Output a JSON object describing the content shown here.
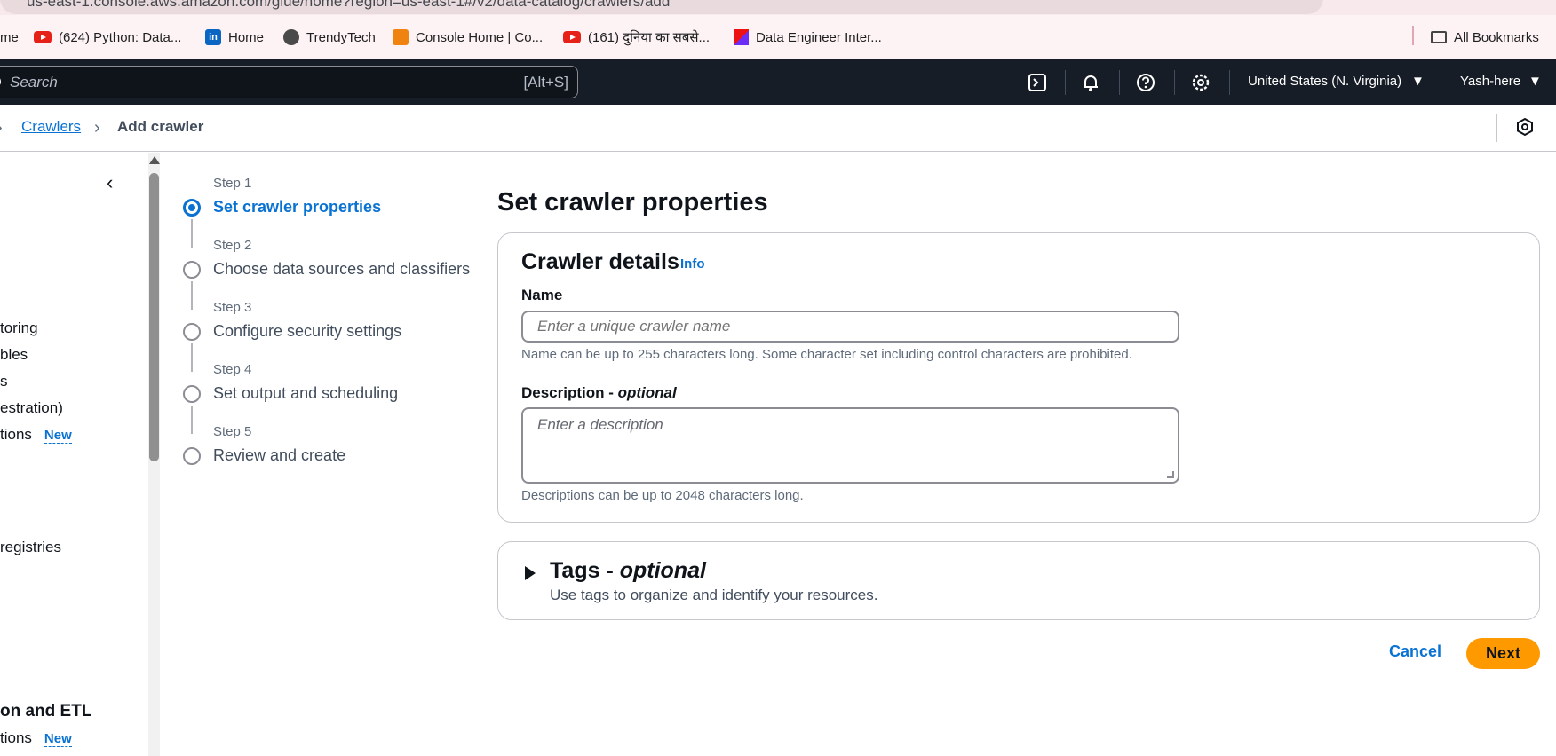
{
  "browser": {
    "url": "us-east-1.console.aws.amazon.com/glue/home?region=us-east-1#/v2/data-catalog/crawlers/add",
    "bookmarks": [
      {
        "label": "me",
        "icon": "none"
      },
      {
        "label": "(624) Python: Data...",
        "icon": "youtube-icon"
      },
      {
        "label": "Home",
        "icon": "linkedin-icon"
      },
      {
        "label": "TrendyTech",
        "icon": "globe-icon"
      },
      {
        "label": "Console Home | Co...",
        "icon": "aws-cube-icon"
      },
      {
        "label": "(161) दुनिया का सबसे...",
        "icon": "youtube-icon"
      },
      {
        "label": "Data Engineer Inter...",
        "icon": "brand-icon"
      }
    ],
    "all_bookmarks": "All Bookmarks"
  },
  "topnav": {
    "search_placeholder": "Search",
    "search_shortcut": "[Alt+S]",
    "region": "United States (N. Virginia)",
    "user": "Yash-here"
  },
  "breadcrumb": {
    "parent": "Crawlers",
    "current": "Add crawler"
  },
  "sidebar": {
    "items": [
      {
        "label": "toring",
        "badge": ""
      },
      {
        "label": "bles",
        "badge": ""
      },
      {
        "label": "s",
        "badge": ""
      },
      {
        "label": "estration)",
        "badge": ""
      },
      {
        "label": "tions",
        "badge": "New"
      },
      {
        "label": "registries",
        "badge": ""
      }
    ],
    "heading": "on and ETL",
    "last_item": {
      "label": "tions",
      "badge": "New"
    }
  },
  "steps": [
    {
      "label": "Step 1",
      "title": "Set crawler properties",
      "active": true
    },
    {
      "label": "Step 2",
      "title": "Choose data sources and classifiers",
      "active": false
    },
    {
      "label": "Step 3",
      "title": "Configure security settings",
      "active": false
    },
    {
      "label": "Step 4",
      "title": "Set output and scheduling",
      "active": false
    },
    {
      "label": "Step 5",
      "title": "Review and create",
      "active": false
    }
  ],
  "main": {
    "page_title": "Set crawler properties",
    "card_title": "Crawler details",
    "info": "Info",
    "name_label": "Name",
    "name_placeholder": "Enter a unique crawler name",
    "name_hint": "Name can be up to 255 characters long. Some character set including control characters are prohibited.",
    "desc_label": "Description - ",
    "desc_optional": "optional",
    "desc_placeholder": "Enter a description",
    "desc_hint": "Descriptions can be up to 2048 characters long.",
    "tags_title": "Tags - ",
    "tags_optional": "optional",
    "tags_desc": "Use tags to organize and identify your resources.",
    "cancel": "Cancel",
    "next": "Next"
  },
  "colors": {
    "accent": "#0972d3",
    "primary_button": "#ff9900",
    "topnav_bg": "#161d26"
  }
}
